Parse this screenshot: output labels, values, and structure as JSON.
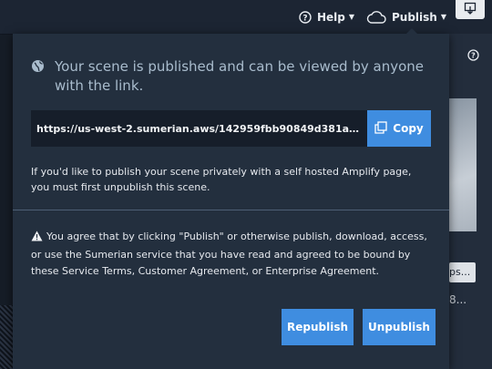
{
  "topbar": {
    "help_label": "Help",
    "publish_label": "Publish"
  },
  "background": {
    "partial_button_text": "ps...",
    "partial_text": "8..."
  },
  "popover": {
    "status_text": "Your scene is published and can be viewed by anyone with the link.",
    "share_link": "https://us-west-2.sumerian.aws/142959fbb90849d381aa7fcdc...",
    "copy_label": "Copy",
    "private_note": "If you'd like to publish your scene privately with a self hosted Amplify page, you must first unpublish this scene.",
    "agreement_text": "You agree that by clicking \"Publish\" or otherwise publish, download, access, or use the Sumerian service that you have read and agreed to be bound by these Service Terms, Customer Agreement, or Enterprise Agreement.",
    "republish_label": "Republish",
    "unpublish_label": "Unpublish"
  },
  "colors": {
    "accent": "#3f8de0",
    "popover_bg": "#232f3e",
    "status_text": "#a9bccd"
  },
  "icons": [
    "help-circle-icon",
    "cloud-icon",
    "export-icon",
    "globe-icon",
    "copy-icon",
    "warning-icon"
  ]
}
